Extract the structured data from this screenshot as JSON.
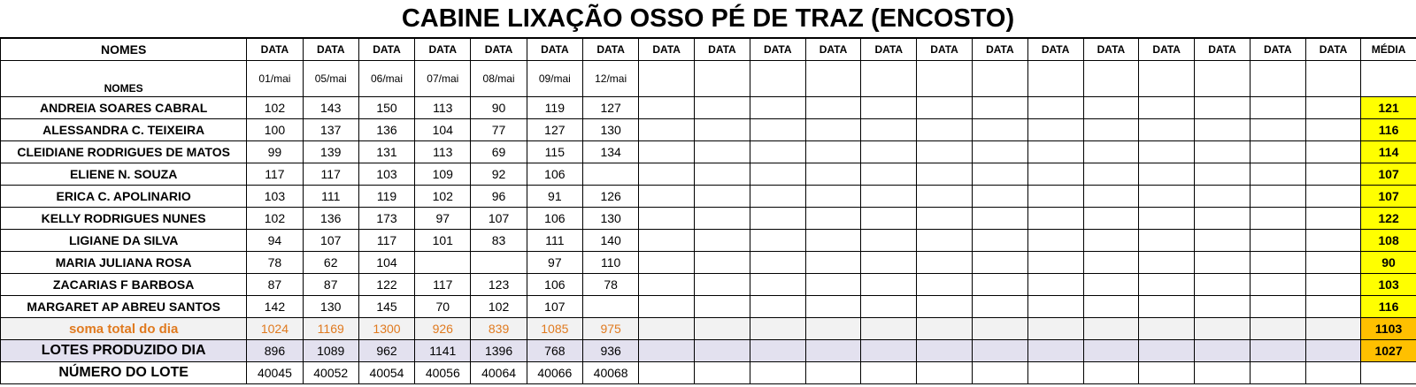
{
  "title": "CABINE LIXAÇÃO OSSO PÉ DE TRAZ (ENCOSTO)",
  "header": {
    "names_label": "NOMES",
    "names_label_2": "NOMES",
    "date_label": "DATA",
    "avg_label": "MÉDIA",
    "date_count": 20,
    "dates": [
      "01/mai",
      "05/mai",
      "06/mai",
      "07/mai",
      "08/mai",
      "09/mai",
      "12/mai"
    ]
  },
  "rows": [
    {
      "name": "ANDREIA SOARES CABRAL",
      "values": [
        "102",
        "143",
        "150",
        "113",
        "90",
        "119",
        "127"
      ],
      "avg": "121"
    },
    {
      "name": "ALESSANDRA C. TEIXEIRA",
      "values": [
        "100",
        "137",
        "136",
        "104",
        "77",
        "127",
        "130"
      ],
      "avg": "116"
    },
    {
      "name": "CLEIDIANE RODRIGUES DE MATOS",
      "values": [
        "99",
        "139",
        "131",
        "113",
        "69",
        "115",
        "134"
      ],
      "avg": "114"
    },
    {
      "name": "ELIENE N. SOUZA",
      "values": [
        "117",
        "117",
        "103",
        "109",
        "92",
        "106",
        ""
      ],
      "avg": "107"
    },
    {
      "name": "ERICA C. APOLINARIO",
      "values": [
        "103",
        "111",
        "119",
        "102",
        "96",
        "91",
        "126"
      ],
      "avg": "107"
    },
    {
      "name": "KELLY RODRIGUES NUNES",
      "values": [
        "102",
        "136",
        "173",
        "97",
        "107",
        "106",
        "130"
      ],
      "avg": "122"
    },
    {
      "name": "LIGIANE DA SILVA",
      "values": [
        "94",
        "107",
        "117",
        "101",
        "83",
        "111",
        "140"
      ],
      "avg": "108"
    },
    {
      "name": "MARIA JULIANA ROSA",
      "values": [
        "78",
        "62",
        "104",
        "",
        "",
        "97",
        "110"
      ],
      "avg": "90"
    },
    {
      "name": "ZACARIAS F BARBOSA",
      "values": [
        "87",
        "87",
        "122",
        "117",
        "123",
        "106",
        "78"
      ],
      "avg": "103"
    },
    {
      "name": "MARGARET AP ABREU SANTOS",
      "values": [
        "142",
        "130",
        "145",
        "70",
        "102",
        "107",
        ""
      ],
      "avg": "116"
    }
  ],
  "totals": {
    "soma": {
      "label": "soma total  do dia",
      "values": [
        "1024",
        "1169",
        "1300",
        "926",
        "839",
        "1085",
        "975"
      ],
      "avg": "1103"
    },
    "lotes": {
      "label": "LOTES PRODUZIDO DIA",
      "values": [
        "896",
        "1089",
        "962",
        "1141",
        "1396",
        "768",
        "936"
      ],
      "avg": "1027"
    },
    "numero": {
      "label": "NÚMERO DO LOTE",
      "values": [
        "40045",
        "40052",
        "40054",
        "40056",
        "40064",
        "40066",
        "40068"
      ],
      "avg": ""
    }
  },
  "colors": {
    "avg_bg": "#ffff00",
    "total_avg_bg": "#ffc000",
    "soma_text": "#e07a1f",
    "lotes_bg": "#e3e1ef"
  }
}
